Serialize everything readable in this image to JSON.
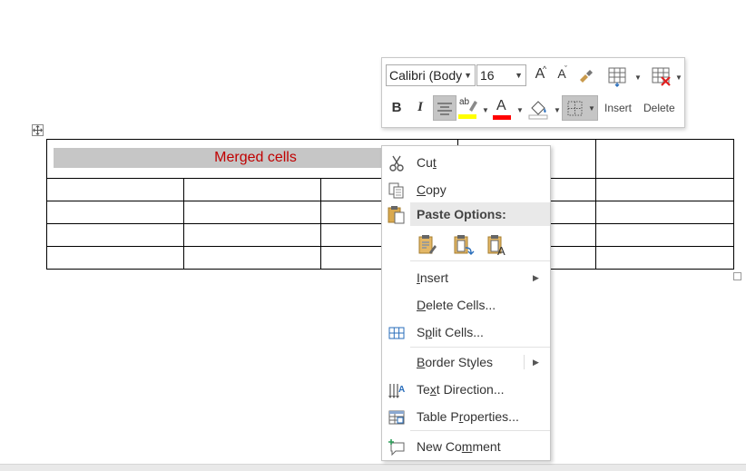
{
  "table": {
    "merged_label": "Merged cells",
    "colors": {
      "merged_fill": "#c6c6c6",
      "merged_text": "#c00000"
    }
  },
  "mini_toolbar": {
    "font_name": "Calibri (Body)",
    "font_size": "16",
    "grow_font_label": "A",
    "shrink_font_label": "A",
    "bold_label": "B",
    "italic_label": "I",
    "highlight_label": "ab",
    "font_color_label": "A",
    "insert_label": "Insert",
    "delete_label": "Delete",
    "colors": {
      "highlight": "#ffff00",
      "font_color": "#ff0000"
    }
  },
  "context_menu": {
    "cut": {
      "pre": "Cu",
      "key": "t",
      "post": ""
    },
    "copy": {
      "pre": "",
      "key": "C",
      "post": "opy"
    },
    "paste_options": "Paste Options:",
    "insert": {
      "pre": "",
      "key": "I",
      "post": "nsert"
    },
    "delete_cells": {
      "pre": "",
      "key": "D",
      "post": "elete Cells..."
    },
    "split_cells": {
      "pre": "S",
      "key": "p",
      "post": "lit Cells..."
    },
    "border_styles": {
      "pre": "",
      "key": "B",
      "post": "order Styles"
    },
    "text_direction": {
      "pre": "Te",
      "key": "x",
      "post": "t Direction..."
    },
    "table_properties": {
      "pre": "Table P",
      "key": "r",
      "post": "operties..."
    },
    "new_comment": {
      "pre": "New Co",
      "key": "m",
      "post": "ment"
    }
  }
}
